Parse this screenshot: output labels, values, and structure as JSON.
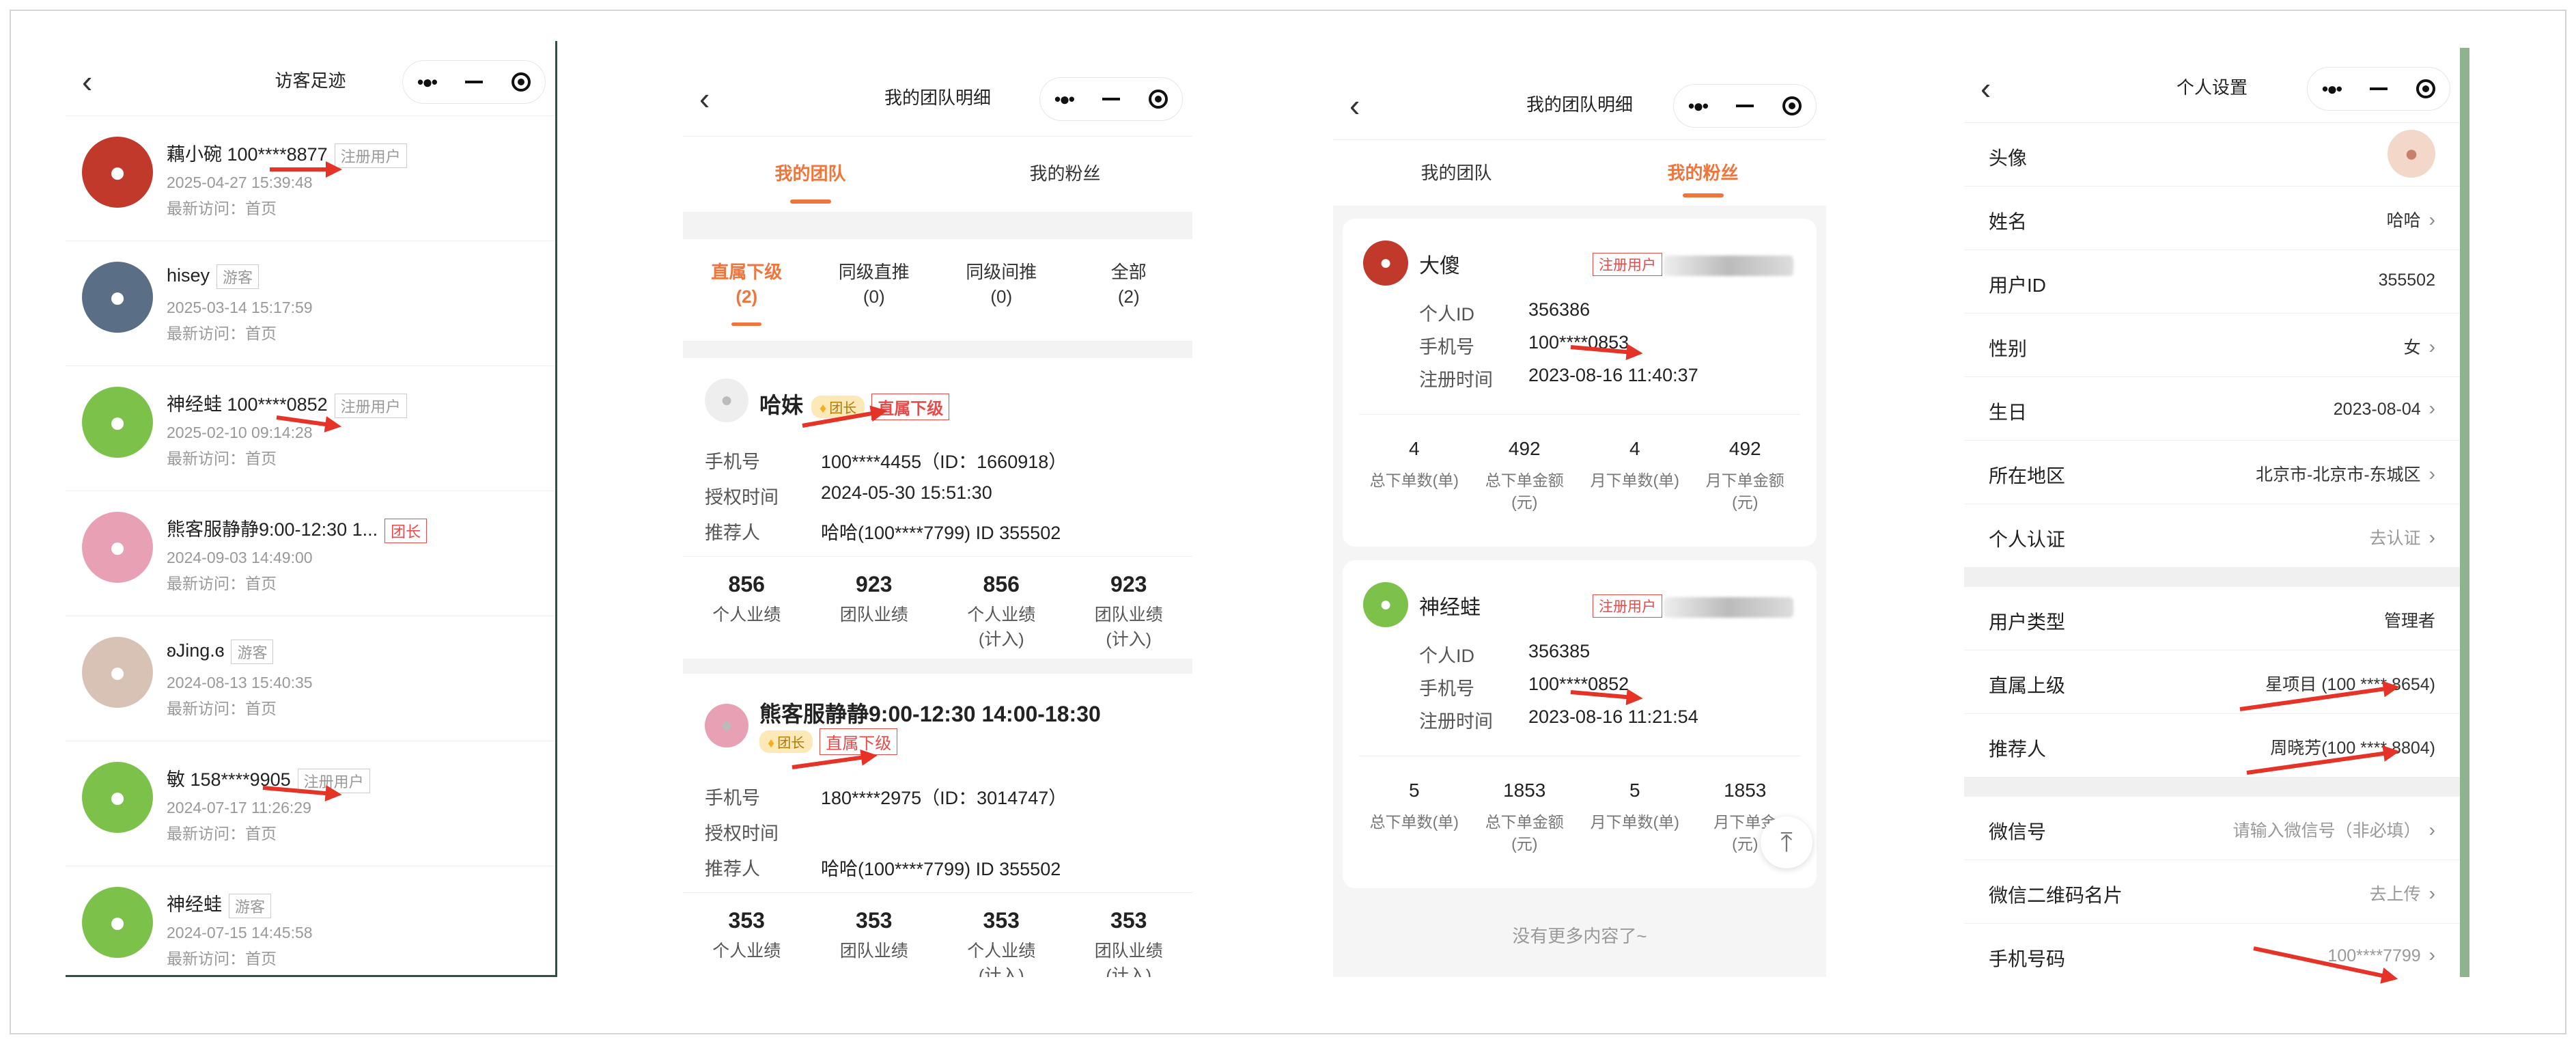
{
  "visitors": {
    "title": "访客足迹",
    "items": [
      {
        "name": "藕小碗 100****8877",
        "tag": "注册用户",
        "time": "2025-04-27 15:39:48",
        "page": "最新访问：首页",
        "avatar": "red-avatar",
        "color": "#c0392b",
        "red": false
      },
      {
        "name": "hisey",
        "tag": "游客",
        "time": "2025-03-14 15:17:59",
        "page": "最新访问：首页",
        "avatar": "person-avatar",
        "color": "#5a6f86",
        "red": false
      },
      {
        "name": "神经蛙 100****0852",
        "tag": "注册用户",
        "time": "2025-02-10 09:14:28",
        "page": "最新访问：首页",
        "avatar": "frog-avatar",
        "color": "#7cc24a",
        "red": false
      },
      {
        "name": "熊客服静静9:00-12:30 1...",
        "tag": "团长",
        "time": "2024-09-03 14:49:00",
        "page": "最新访问：首页",
        "avatar": "cartoon-avatar",
        "color": "#e8a0b4",
        "red": true
      },
      {
        "name": "ʚJing.ɞ",
        "tag": "游客",
        "time": "2024-08-13 15:40:35",
        "page": "最新访问：首页",
        "avatar": "bear-avatar",
        "color": "#d8c2b6",
        "red": false
      },
      {
        "name": "敏 158****9905",
        "tag": "注册用户",
        "time": "2024-07-17 11:26:29",
        "page": "最新访问：首页",
        "avatar": "frog-avatar",
        "color": "#7cc24a",
        "red": false
      },
      {
        "name": "神经蛙",
        "tag": "游客",
        "time": "2024-07-15 14:45:58",
        "page": "最新访问：首页",
        "avatar": "frog-avatar",
        "color": "#7cc24a",
        "red": false
      }
    ]
  },
  "team": {
    "title": "我的团队明细",
    "tabs": [
      "我的团队",
      "我的粉丝"
    ],
    "subtabs": [
      {
        "label": "直属下级",
        "count": "(2)"
      },
      {
        "label": "同级直推",
        "count": "(0)"
      },
      {
        "label": "同级间推",
        "count": "(0)"
      },
      {
        "label": "全部",
        "count": "(2)"
      }
    ],
    "members": [
      {
        "name": "哈妹",
        "badge": "团长",
        "tag": "直属下级",
        "phone_label": "手机号",
        "phone": "100****4455（ID：1660918）",
        "auth_label": "授权时间",
        "auth": "2024-05-30 15:51:30",
        "ref_label": "推荐人",
        "ref": "哈哈(100****7799) ID 355502",
        "stats": [
          {
            "n": "856",
            "l": "个人业绩"
          },
          {
            "n": "923",
            "l": "团队业绩"
          },
          {
            "n": "856",
            "l": "个人业绩\n(计入)"
          },
          {
            "n": "923",
            "l": "团队业绩\n(计入)"
          }
        ]
      },
      {
        "name": "熊客服静静9:00-12:30 14:00-18:30",
        "badge": "团长",
        "tag": "直属下级",
        "phone_label": "手机号",
        "phone": "180****2975（ID：3014747）",
        "auth_label": "授权时间",
        "auth": "",
        "ref_label": "推荐人",
        "ref": "哈哈(100****7799) ID 355502",
        "stats": [
          {
            "n": "353",
            "l": "个人业绩"
          },
          {
            "n": "353",
            "l": "团队业绩"
          },
          {
            "n": "353",
            "l": "个人业绩\n(计入)"
          },
          {
            "n": "353",
            "l": "团队业绩\n(计入)"
          }
        ]
      }
    ]
  },
  "fans": {
    "title": "我的团队明细",
    "tabs": [
      "我的团队",
      "我的粉丝"
    ],
    "items": [
      {
        "name": "大傻",
        "tag": "注册用户",
        "id_label": "个人ID",
        "id": "356386",
        "phone_label": "手机号",
        "phone": "100****0853",
        "reg_label": "注册时间",
        "reg": "2023-08-16 11:40:37",
        "stats": [
          {
            "n": "4",
            "l": "总下单数(单)"
          },
          {
            "n": "492",
            "l": "总下单金额\n(元)"
          },
          {
            "n": "4",
            "l": "月下单数(单)"
          },
          {
            "n": "492",
            "l": "月下单金额\n(元)"
          }
        ]
      },
      {
        "name": "神经蛙",
        "tag": "注册用户",
        "id_label": "个人ID",
        "id": "356385",
        "phone_label": "手机号",
        "phone": "100****0852",
        "reg_label": "注册时间",
        "reg": "2023-08-16 11:21:54",
        "stats": [
          {
            "n": "5",
            "l": "总下单数(单)"
          },
          {
            "n": "1853",
            "l": "总下单金额\n(元)"
          },
          {
            "n": "5",
            "l": "月下单数(单)"
          },
          {
            "n": "1853",
            "l": "月下单金\n(元)"
          }
        ]
      }
    ],
    "no_more": "没有更多内容了~"
  },
  "settings": {
    "title": "个人设置",
    "group1": [
      {
        "label": "头像",
        "value": "",
        "avatar": true
      },
      {
        "label": "姓名",
        "value": "哈哈",
        "chev": true
      },
      {
        "label": "用户ID",
        "value": "355502",
        "chev": false
      },
      {
        "label": "性别",
        "value": "女",
        "chev": true
      },
      {
        "label": "生日",
        "value": "2023-08-04",
        "chev": true
      },
      {
        "label": "所在地区",
        "value": "北京市-北京市-东城区",
        "chev": true
      },
      {
        "label": "个人认证",
        "value": "去认证",
        "chev": true,
        "grey": true
      }
    ],
    "group2": [
      {
        "label": "用户类型",
        "value": "管理者",
        "chev": false
      },
      {
        "label": "直属上级",
        "value": "星项目 (100 **** 8654)",
        "chev": false
      },
      {
        "label": "推荐人",
        "value": "周晓芳(100 **** 8804)",
        "chev": false
      }
    ],
    "group3": [
      {
        "label": "微信号",
        "value": "请输入微信号（非必填）",
        "chev": true,
        "grey": true
      },
      {
        "label": "微信二维码名片",
        "value": "去上传",
        "chev": true,
        "grey": true
      },
      {
        "label": "手机号码",
        "value": "100****7799",
        "chev": true,
        "grey": true
      }
    ]
  }
}
